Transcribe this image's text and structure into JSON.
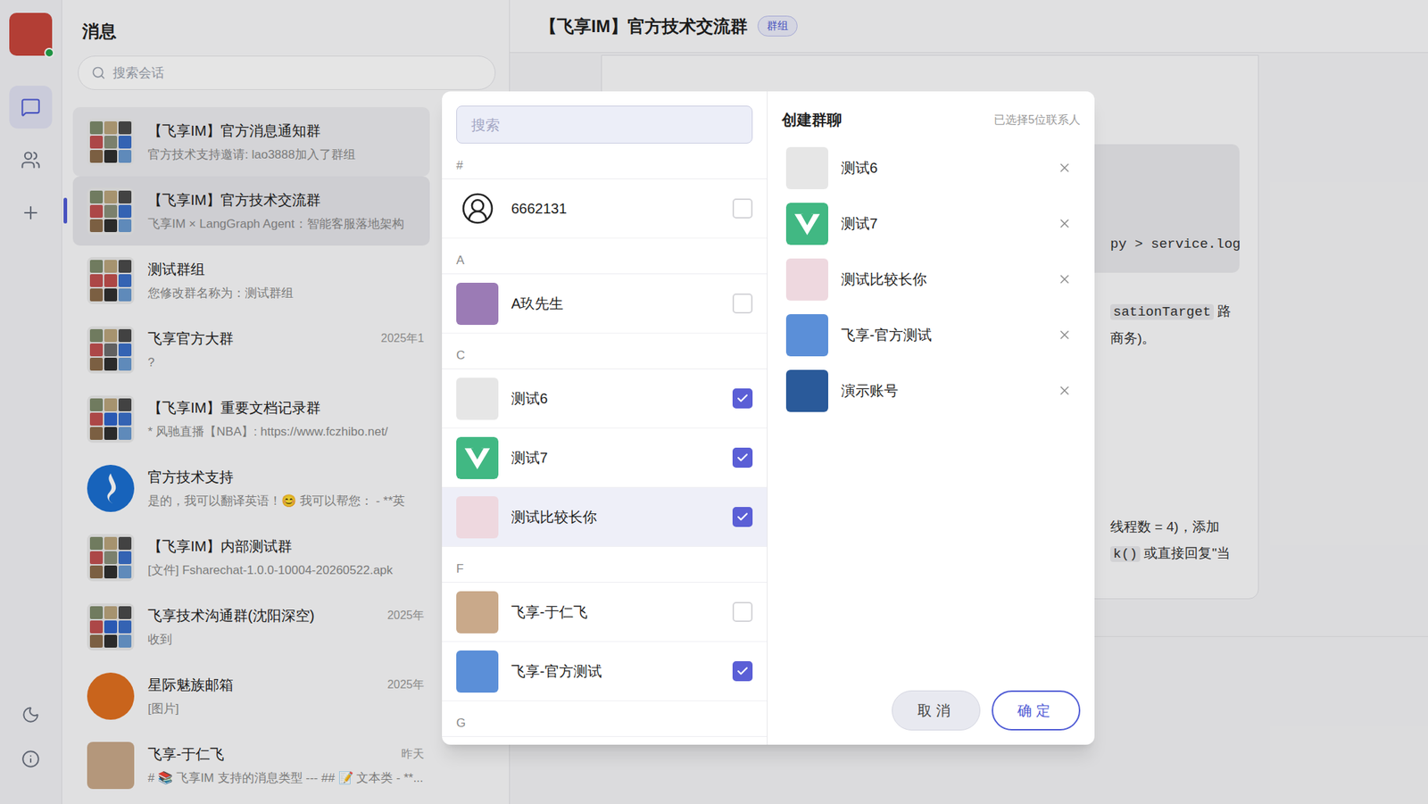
{
  "app": {
    "title": "消息",
    "search_placeholder": "搜索会话",
    "online": true
  },
  "rail": [
    {
      "kind": "messages",
      "selected": true
    },
    {
      "kind": "contacts",
      "selected": false
    },
    {
      "kind": "add",
      "selected": false
    }
  ],
  "conversations": [
    {
      "name": "【飞享IM】官方消息通知群",
      "preview": "官方技术支持邀请: lao3888加入了群组",
      "time": "",
      "kind": "group",
      "color": "#8a8f7a",
      "selected": false,
      "hovered": true
    },
    {
      "name": "【飞享IM】官方技术交流群",
      "preview": "飞享IM × LangGraph Agent：智能客服落地架构",
      "time": "",
      "kind": "group",
      "color": "#8a8f7a",
      "selected": true,
      "hovered": false
    },
    {
      "name": "测试群组",
      "preview": "您修改群名称为：测试群组",
      "time": "",
      "kind": "group",
      "color": "#c0504d",
      "selected": false,
      "hovered": false
    },
    {
      "name": "飞享官方大群",
      "preview": "?",
      "time": "2025年1",
      "kind": "group",
      "color": "#6b6b6b",
      "selected": false,
      "hovered": false
    },
    {
      "name": "【飞享IM】重要文档记录群",
      "preview": "* 风驰直播【NBA】: https://www.fczhibo.net/",
      "time": "",
      "kind": "group",
      "color": "#2f64c8",
      "selected": false,
      "hovered": false
    },
    {
      "name": "官方技术支持",
      "preview": "是的，我可以翻译英语！😊 我可以帮您： - **英",
      "time": "",
      "kind": "logo",
      "color": "#1a6fd1",
      "selected": false,
      "hovered": false
    },
    {
      "name": "【飞享IM】内部测试群",
      "preview": "[文件] Fsharechat-1.0.0-10004-20260522.apk",
      "time": "",
      "kind": "group",
      "color": "#8a8f7a",
      "selected": false,
      "hovered": false
    },
    {
      "name": "飞享技术沟通群(沈阳深空)",
      "preview": "收到",
      "time": "2025年",
      "kind": "group",
      "color": "#2f64c8",
      "selected": false,
      "hovered": false
    },
    {
      "name": "星际魅族邮箱",
      "preview": "[图片]",
      "time": "2025年",
      "kind": "round",
      "color": "#e07020",
      "selected": false,
      "hovered": false
    },
    {
      "name": "飞享-于仁飞",
      "preview": "# 📚 飞享IM 支持的消息类型 --- ## 📝 文本类 - **...",
      "time": "昨天",
      "kind": "photo",
      "color": "#c9a98a",
      "selected": false,
      "hovered": false
    }
  ],
  "chat": {
    "title": "【飞享IM】官方技术交流群",
    "badge": "群组",
    "code_line": "py > service.log",
    "line1_code": "sationTarget",
    "line1_text": " 路",
    "line2_text": "商务)。",
    "line3_text": "线程数 = 4)，添加",
    "line4_code": "k()",
    "line4_text": " 或直接回复\"当"
  },
  "dialog": {
    "search_placeholder": "搜索",
    "title": "创建群聊",
    "summary": "已选择5位联系人",
    "sections": [
      {
        "letter": "#",
        "contacts": [
          {
            "name": "6662131",
            "kind": "default",
            "color": "#ffffff",
            "checked": false,
            "hovered": false
          }
        ]
      },
      {
        "letter": "A",
        "contacts": [
          {
            "name": "A玖先生",
            "kind": "photo",
            "color": "#9b7bb5",
            "checked": false,
            "hovered": false
          }
        ]
      },
      {
        "letter": "C",
        "contacts": [
          {
            "name": "测试6",
            "kind": "photo",
            "color": "#e6e6e6",
            "checked": true,
            "hovered": false
          },
          {
            "name": "测试7",
            "kind": "vue",
            "color": "#41b883",
            "checked": true,
            "hovered": false
          },
          {
            "name": "测试比较长你",
            "kind": "photo",
            "color": "#eed8df",
            "checked": true,
            "hovered": true
          }
        ]
      },
      {
        "letter": "F",
        "contacts": [
          {
            "name": "飞享-于仁飞",
            "kind": "photo",
            "color": "#c9a98a",
            "checked": false,
            "hovered": false
          },
          {
            "name": "飞享-官方测试",
            "kind": "photo",
            "color": "#5b8fd8",
            "checked": true,
            "hovered": false
          }
        ]
      },
      {
        "letter": "G",
        "contacts": []
      }
    ],
    "selected": [
      {
        "name": "测试6",
        "kind": "photo",
        "color": "#e6e6e6"
      },
      {
        "name": "测试7",
        "kind": "vue",
        "color": "#41b883"
      },
      {
        "name": "测试比较长你",
        "kind": "photo",
        "color": "#eed8df"
      },
      {
        "name": "飞享-官方测试",
        "kind": "photo",
        "color": "#5b8fd8"
      },
      {
        "name": "演示账号",
        "kind": "photo",
        "color": "#2a5a9a"
      }
    ],
    "buttons": [
      {
        "label": "取消",
        "kind": "secondary"
      },
      {
        "label": "确定",
        "kind": "primary"
      }
    ]
  }
}
